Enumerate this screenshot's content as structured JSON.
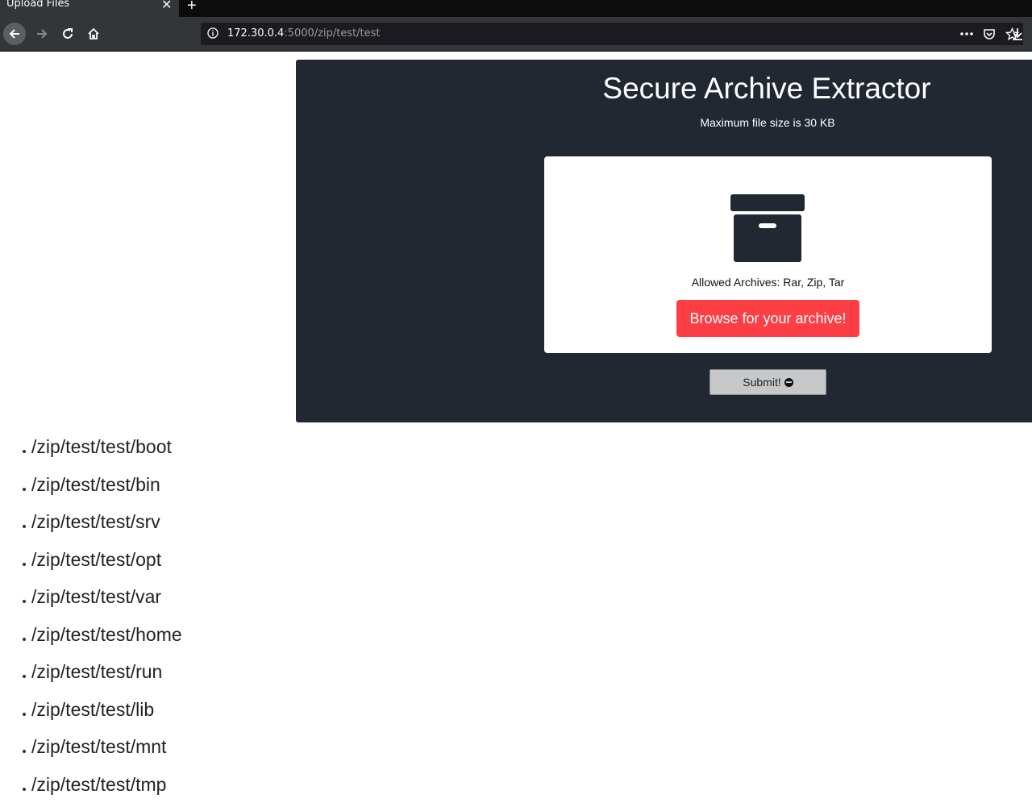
{
  "browser": {
    "tab_title": "Upload Files",
    "tab_close": "✕",
    "new_tab": "+",
    "url_host": "172.30.0.4",
    "url_path": ":5000/zip/test/test"
  },
  "page": {
    "title": "Secure Archive Extractor",
    "subtitle": "Maximum file size is 30 KB",
    "allowed": "Allowed Archives: Rar, Zip, Tar",
    "browse_label": "Browse for your archive!",
    "submit_label": "Submit!",
    "colors": {
      "panel": "#212832",
      "browse_button": "#fd3e45",
      "submit_button": "#c7c8ca"
    }
  },
  "paths": [
    "/zip/test/test/boot",
    "/zip/test/test/bin",
    "/zip/test/test/srv",
    "/zip/test/test/opt",
    "/zip/test/test/var",
    "/zip/test/test/home",
    "/zip/test/test/run",
    "/zip/test/test/lib",
    "/zip/test/test/mnt",
    "/zip/test/test/tmp"
  ]
}
